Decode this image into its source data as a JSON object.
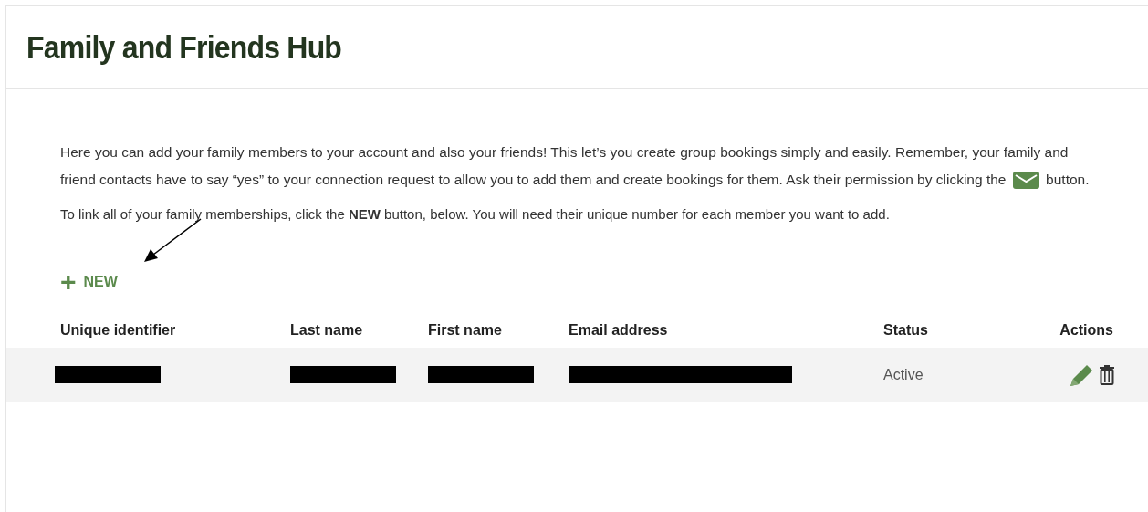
{
  "title": "Family and Friends Hub",
  "intro": {
    "before_icon": "Here you can add your family members to your account and also your friends! This let’s you create group bookings simply and easily. Remember, your family and friend contacts have to say “yes” to your connection request to allow you to add them and create bookings for them. Ask their permission by clicking the",
    "after_icon": "button."
  },
  "instruction": "To link all of your family memberships, click the **NEW** button, below. You will need their unique number for each member you want to add.",
  "new_button": {
    "icon": "+",
    "label": "NEW"
  },
  "annotation": {
    "kind": "arrow"
  },
  "table": {
    "columns": [
      "Unique identifier",
      "Last name",
      "First name",
      "Email address",
      "Status",
      "Actions"
    ],
    "rows": [
      {
        "cells": [
          {
            "kind": "redacted"
          },
          {
            "kind": "redacted"
          },
          {
            "kind": "redacted"
          },
          {
            "kind": "redacted"
          },
          {
            "kind": "text",
            "text": "Active"
          },
          {
            "kind": "actions"
          }
        ]
      }
    ]
  }
}
